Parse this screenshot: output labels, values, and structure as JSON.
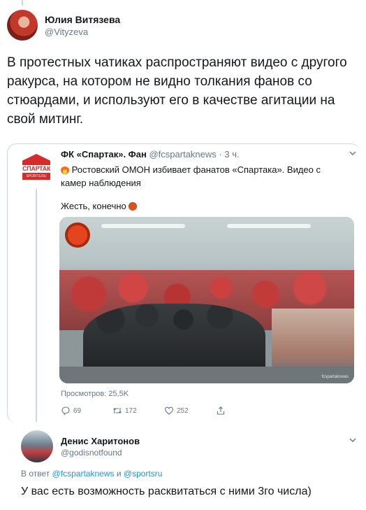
{
  "main_tweet": {
    "author_name": "Юлия Витязева",
    "author_handle": "@Vityzeva",
    "text": "В протестных чатиках распространяют видео с другого ракурса, на котором не видно толкания фанов со стюардами, и используют его в качестве агитации на свой митинг."
  },
  "quoted_tweet": {
    "logo_word": "СПАРТАК",
    "logo_sub": "SPORTS.RU",
    "author_name": "ФК «Спартак». Фан",
    "author_handle": "@fcspartaknews",
    "time": "· 3 ч.",
    "emoji_first": "fire-emoji",
    "text": "Ростовский ОМОН избивает фанатов «Спартака». Видео с камер наблюдения",
    "text2": "Жесть, конечно",
    "emoji_second": "angry-face-emoji",
    "video_watermark": "fcspartaknews",
    "views": "Просмотров: 25,5K",
    "actions": {
      "reply_count": "69",
      "retweet_count": "172",
      "like_count": "252",
      "icons": [
        "reply-icon",
        "retweet-icon",
        "like-icon",
        "share-icon"
      ]
    }
  },
  "reply": {
    "author_name": "Денис Харитонов",
    "author_handle": "@godisnotfound",
    "replying_prefix": "В ответ",
    "replying_to_1": "@fcspartaknews",
    "replying_and": "и",
    "replying_to_2": "@sportsru",
    "text": "У вас есть возможность расквитаться с ними 3го числа)"
  },
  "colors": {
    "text": "#14171a",
    "muted": "#657786",
    "link": "#1b95e0",
    "border": "#ccd6dd",
    "spartak_red": "#d62b2b"
  }
}
